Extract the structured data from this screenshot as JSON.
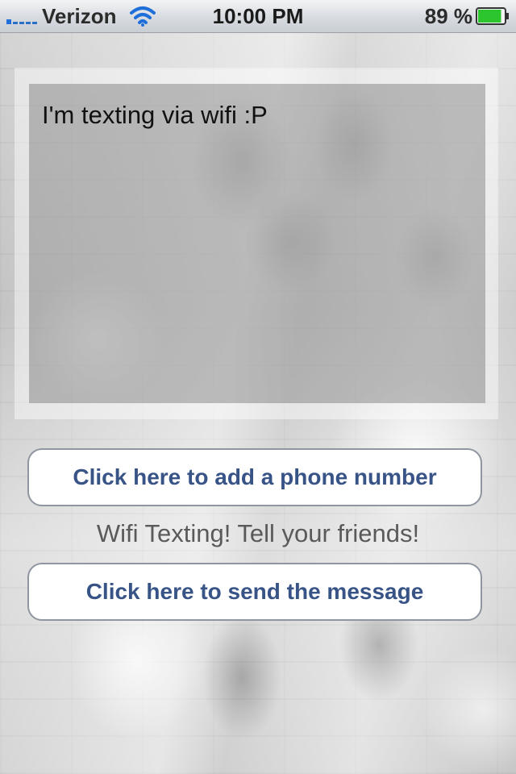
{
  "status_bar": {
    "carrier": "Verizon",
    "time": "10:00 PM",
    "battery_percent": "89 %",
    "battery_level": 0.89,
    "signal_icon": "signal-bars-icon",
    "wifi_icon": "wifi-icon",
    "battery_icon": "battery-icon"
  },
  "message": {
    "text": "I'm texting via wifi :P"
  },
  "buttons": {
    "add_phone_label": "Click here to add a phone number",
    "send_label": "Click here to send the message"
  },
  "tagline": "Wifi Texting! Tell your friends!",
  "colors": {
    "button_text": "#385487",
    "signal": "#1e6fd9",
    "battery_fill": "#2dc52d"
  }
}
